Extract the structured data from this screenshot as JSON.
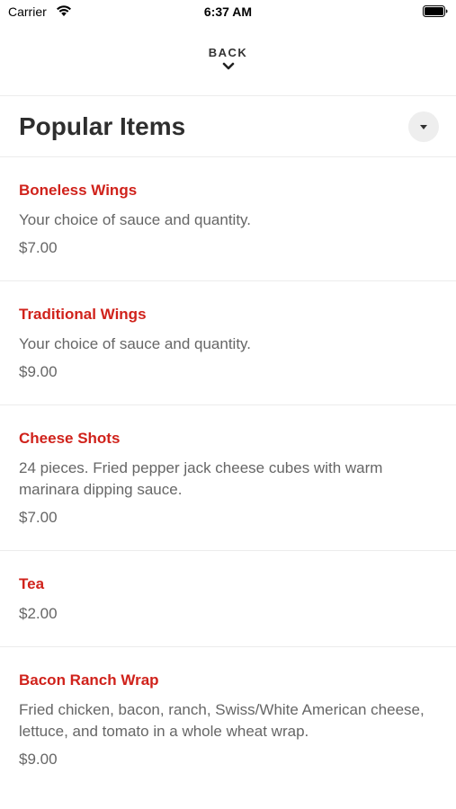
{
  "status_bar": {
    "carrier": "Carrier",
    "time": "6:37 AM",
    "wifi_icon": "wifi-icon",
    "battery_icon": "battery-icon"
  },
  "nav": {
    "back_label": "BACK",
    "back_icon": "chevron-down-icon"
  },
  "section": {
    "title": "Popular Items",
    "dropdown_icon": "caret-down-icon"
  },
  "colors": {
    "item_name": "#d0221b",
    "text_secondary": "#666666",
    "title": "#2e2e2e",
    "divider": "#ececec"
  },
  "items": [
    {
      "name": "Boneless Wings",
      "description": "Your choice of sauce and quantity.",
      "price": "$7.00"
    },
    {
      "name": "Traditional Wings",
      "description": "Your choice of sauce and quantity.",
      "price": "$9.00"
    },
    {
      "name": "Cheese Shots",
      "description": "24 pieces. Fried pepper jack cheese cubes with warm marinara dipping sauce.",
      "price": "$7.00"
    },
    {
      "name": "Tea",
      "description": "",
      "price": "$2.00"
    },
    {
      "name": "Bacon Ranch Wrap",
      "description": "Fried chicken, bacon, ranch, Swiss/White American cheese, lettuce, and tomato in a whole wheat wrap.",
      "price": "$9.00"
    }
  ]
}
